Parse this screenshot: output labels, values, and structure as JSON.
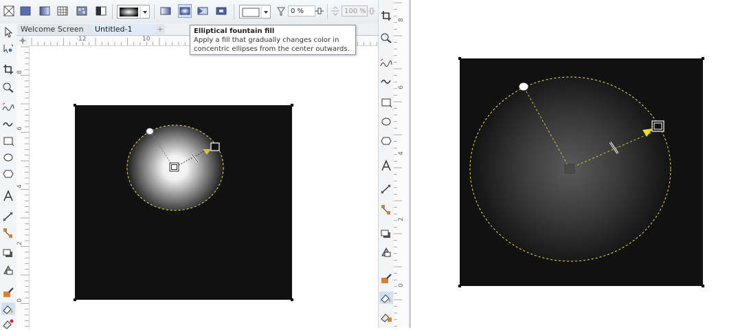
{
  "toolbar": {
    "tools": [
      {
        "icon": "no-fill-icon"
      },
      {
        "icon": "uniform-fill-icon"
      },
      {
        "icon": "fountain-fill-icon"
      },
      {
        "icon": "vector-pattern-fill-icon"
      },
      {
        "icon": "bitmap-pattern-fill-icon"
      },
      {
        "icon": "two-color-pattern-fill-icon"
      }
    ],
    "fountain_types": [
      "linear-fountain-fill-icon",
      "elliptical-fountain-fill-icon",
      "conical-fountain-fill-icon",
      "rectangular-fountain-fill-icon"
    ],
    "transparency_value": "0 %",
    "acceleration_value": "100 %"
  },
  "tabs": {
    "welcome": "Welcome Screen",
    "untitled": "Untitled-1",
    "add": "+"
  },
  "tooltip": {
    "title": "Elliptical fountain fill",
    "description_line1": "Apply a fill that gradually changes color in",
    "description_line2": "concentric ellipses from the center outwards."
  },
  "rulers": {
    "top": [
      "12",
      "10"
    ],
    "left": [
      "8",
      "6",
      "4",
      "2",
      "0"
    ],
    "right": [
      "8",
      "6",
      "4",
      "2",
      "0"
    ]
  },
  "colors": {
    "shape_fill": "#111111",
    "gradient_highlight": "#ffffff",
    "guide": "#f2e84a",
    "handle_marker": "#cfc93a"
  }
}
